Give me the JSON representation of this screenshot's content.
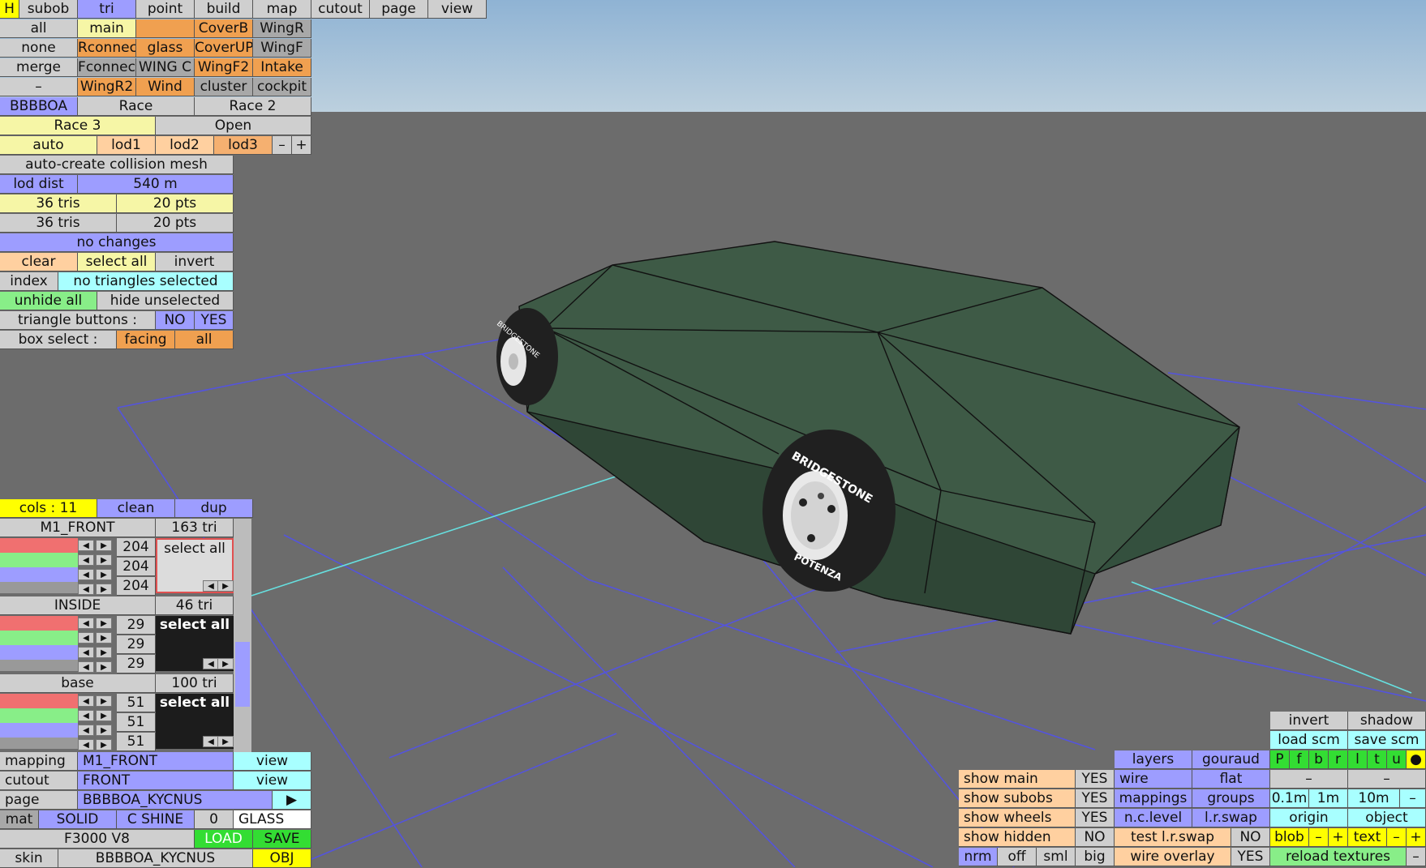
{
  "menu": [
    "H",
    "subob",
    "tri",
    "point",
    "build",
    "map",
    "cutout",
    "page",
    "view"
  ],
  "subobs": {
    "row1": [
      "all",
      "main",
      "",
      "CoverB",
      "WingR"
    ],
    "row2": [
      "none",
      "Rconnec",
      "glass",
      "CoverUP",
      "WingF"
    ],
    "row3": [
      "merge",
      "Fconnec",
      "WING C",
      "WingF2",
      "Intake"
    ],
    "row4": [
      "–",
      "WingR2",
      "Wind",
      "cluster",
      "cockpit"
    ]
  },
  "variants": [
    "BBBBOA",
    "Race",
    "Race 2",
    "Race 3",
    "Open"
  ],
  "lod": [
    "auto",
    "lod1",
    "lod2",
    "lod3",
    "–",
    "+"
  ],
  "collision_label": "auto-create collision mesh",
  "lod_dist": {
    "label": "lod dist",
    "value": "540 m"
  },
  "counts": [
    [
      "36 tris",
      "20 pts"
    ],
    [
      "36 tris",
      "20 pts"
    ]
  ],
  "status": "no changes",
  "selection": {
    "clear": "clear",
    "select_all": "select all",
    "invert": "invert",
    "index": "index",
    "info": "no triangles selected",
    "unhide": "unhide all",
    "hide": "hide unselected"
  },
  "triangle_buttons": {
    "label": "triangle buttons :",
    "no": "NO",
    "yes": "YES"
  },
  "box_select": {
    "label": "box select :",
    "facing": "facing",
    "all": "all"
  },
  "cols": {
    "label": "cols : 11",
    "clean": "clean",
    "dup": "dup"
  },
  "materials": [
    {
      "name": "M1_FRONT",
      "tris": "163 tri",
      "values": [
        "204",
        "204",
        "204"
      ],
      "select": "select all"
    },
    {
      "name": "INSIDE",
      "tris": "46 tri",
      "values": [
        "29",
        "29",
        "29"
      ],
      "select": "select all"
    },
    {
      "name": "base",
      "tris": "100 tri",
      "values": [
        "51",
        "51",
        "51"
      ],
      "select": "select all"
    }
  ],
  "mapping": {
    "label": "mapping",
    "value": "M1_FRONT",
    "view": "view"
  },
  "cutout": {
    "label": "cutout",
    "value": "FRONT",
    "view": "view"
  },
  "page": {
    "label": "page",
    "value": "BBBBOA_KYCNUS",
    "arrow": "▶"
  },
  "mat": {
    "label": "mat",
    "solid": "SOLID",
    "shine": "C SHINE",
    "num": "0",
    "glass": "GLASS"
  },
  "engine": {
    "name": "F3000 V8",
    "load": "LOAD",
    "save": "SAVE"
  },
  "skin": {
    "label": "skin",
    "value": "BBBBOA_KYCNUS",
    "obj": "OBJ"
  },
  "right_top": [
    [
      "invert",
      "shadow"
    ],
    [
      "load scm",
      "save scm"
    ]
  ],
  "flags": [
    "P",
    "f",
    "b",
    "r",
    "l",
    "t",
    "u",
    "●"
  ],
  "layers": {
    "layers": "layers",
    "gouraud": "gouraud",
    "wire": "wire",
    "flat": "flat",
    "mappings": "mappings",
    "groups": "groups",
    "lrswap": "l.r.swap",
    "wire_overlay": "wire overlay",
    "yes": "YES"
  },
  "show": [
    {
      "label": "show main",
      "value": "YES"
    },
    {
      "label": "show subobs",
      "value": "YES"
    },
    {
      "label": "show wheels",
      "value": "YES"
    },
    {
      "label": "show hidden",
      "value": "NO"
    }
  ],
  "view_modes": [
    "nrm",
    "off",
    "sml",
    "big"
  ],
  "test_swap": {
    "label": "test l.r.swap",
    "value": "NO"
  },
  "ncl": {
    "label": "n.c.level"
  },
  "dashes": [
    "–",
    "–"
  ],
  "scales": [
    "0.1m",
    "1m",
    "10m",
    "–"
  ],
  "origin": {
    "origin": "origin",
    "object": "object"
  },
  "blob": {
    "blob": "blob",
    "minus": "–",
    "plus": "+",
    "text": "text",
    "tminus": "–",
    "tplus": "+"
  },
  "reload": {
    "label": "reload textures",
    "minus": "–"
  },
  "tire_brand": "BRIDGESTONE",
  "tire_model": "POTENZA",
  "colors": {
    "body": "#3e5a46",
    "bodyDark": "#2f4636",
    "grid": "#5454dd",
    "axis": "#66e0e0",
    "sky": "#9ab8d2",
    "ground": "#6c6c6c"
  }
}
